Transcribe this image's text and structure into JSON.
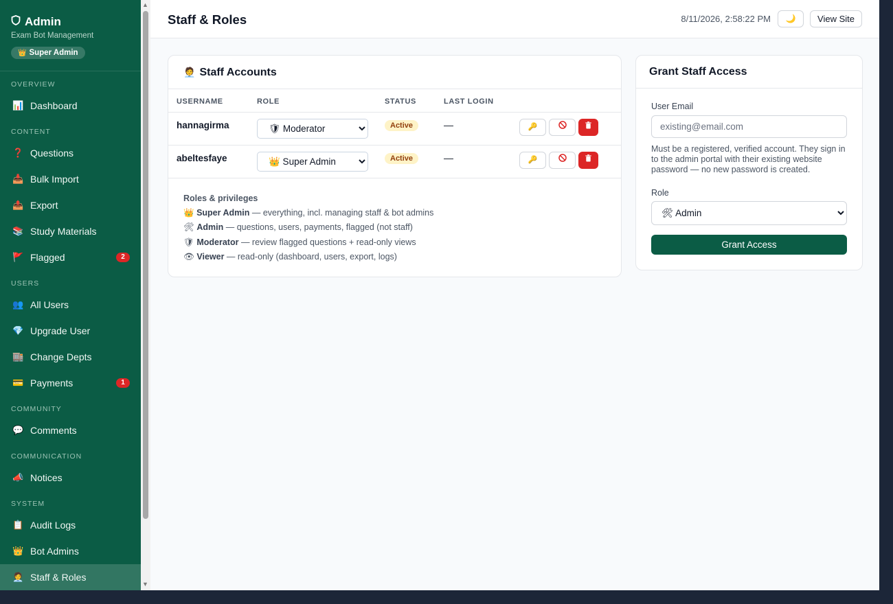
{
  "brand": {
    "title": "Admin",
    "subtitle": "Exam Bot Management",
    "badge": "Super Admin"
  },
  "sidebar": {
    "sections": {
      "overview": "OVERVIEW",
      "content": "CONTENT",
      "users": "USERS",
      "community": "COMMUNITY",
      "communication": "COMMUNICATION",
      "system": "SYSTEM"
    },
    "items": {
      "dashboard": "Dashboard",
      "questions": "Questions",
      "bulk_import": "Bulk Import",
      "export": "Export",
      "study_materials": "Study Materials",
      "flagged": "Flagged",
      "flagged_count": "2",
      "all_users": "All Users",
      "upgrade_user": "Upgrade User",
      "change_depts": "Change Depts",
      "payments": "Payments",
      "payments_count": "1",
      "comments": "Comments",
      "notices": "Notices",
      "audit_logs": "Audit Logs",
      "bot_admins": "Bot Admins",
      "staff_roles": "Staff & Roles"
    }
  },
  "header": {
    "title": "Staff & Roles",
    "timestamp": "8/11/2026, 2:58:22 PM",
    "theme_icon": "🌙",
    "view_site": "View Site"
  },
  "staff": {
    "title": "Staff Accounts",
    "columns": [
      "USERNAME",
      "ROLE",
      "STATUS",
      "LAST LOGIN"
    ],
    "rows": [
      {
        "username": "hannagirma",
        "role": "🛡 Moderator",
        "status": "Active",
        "last_login": "—"
      },
      {
        "username": "abeltesfaye",
        "role": "👑 Super Admin",
        "status": "Active",
        "last_login": "—"
      }
    ],
    "role_options": [
      "👑 Super Admin",
      "🛠 Admin",
      "🛡 Moderator",
      "👁 Viewer"
    ],
    "privileges_title": "Roles & privileges",
    "privileges": [
      {
        "icon": "👑",
        "name": "Super Admin",
        "desc": " — everything, incl. managing staff & bot admins"
      },
      {
        "icon": "🛠",
        "name": "Admin",
        "desc": " — questions, users, payments, flagged (not staff)"
      },
      {
        "icon": "🛡",
        "name": "Moderator",
        "desc": " — review flagged questions + read-only views"
      },
      {
        "icon": "👁",
        "name": "Viewer",
        "desc": " — read-only (dashboard, users, export, logs)"
      }
    ]
  },
  "grant": {
    "title": "Grant Staff Access",
    "email_label": "User Email",
    "email_placeholder": "existing@email.com",
    "hint": "Must be a registered, verified account. They sign in to the admin portal with their existing website password — no new password is created.",
    "role_label": "Role",
    "role_value": "🛠 Admin",
    "button": "Grant Access"
  },
  "colors": {
    "sidebar": "#0b5c45",
    "accent": "#0b5c45",
    "danger": "#dc2626",
    "active_badge": "#fef3c7"
  }
}
